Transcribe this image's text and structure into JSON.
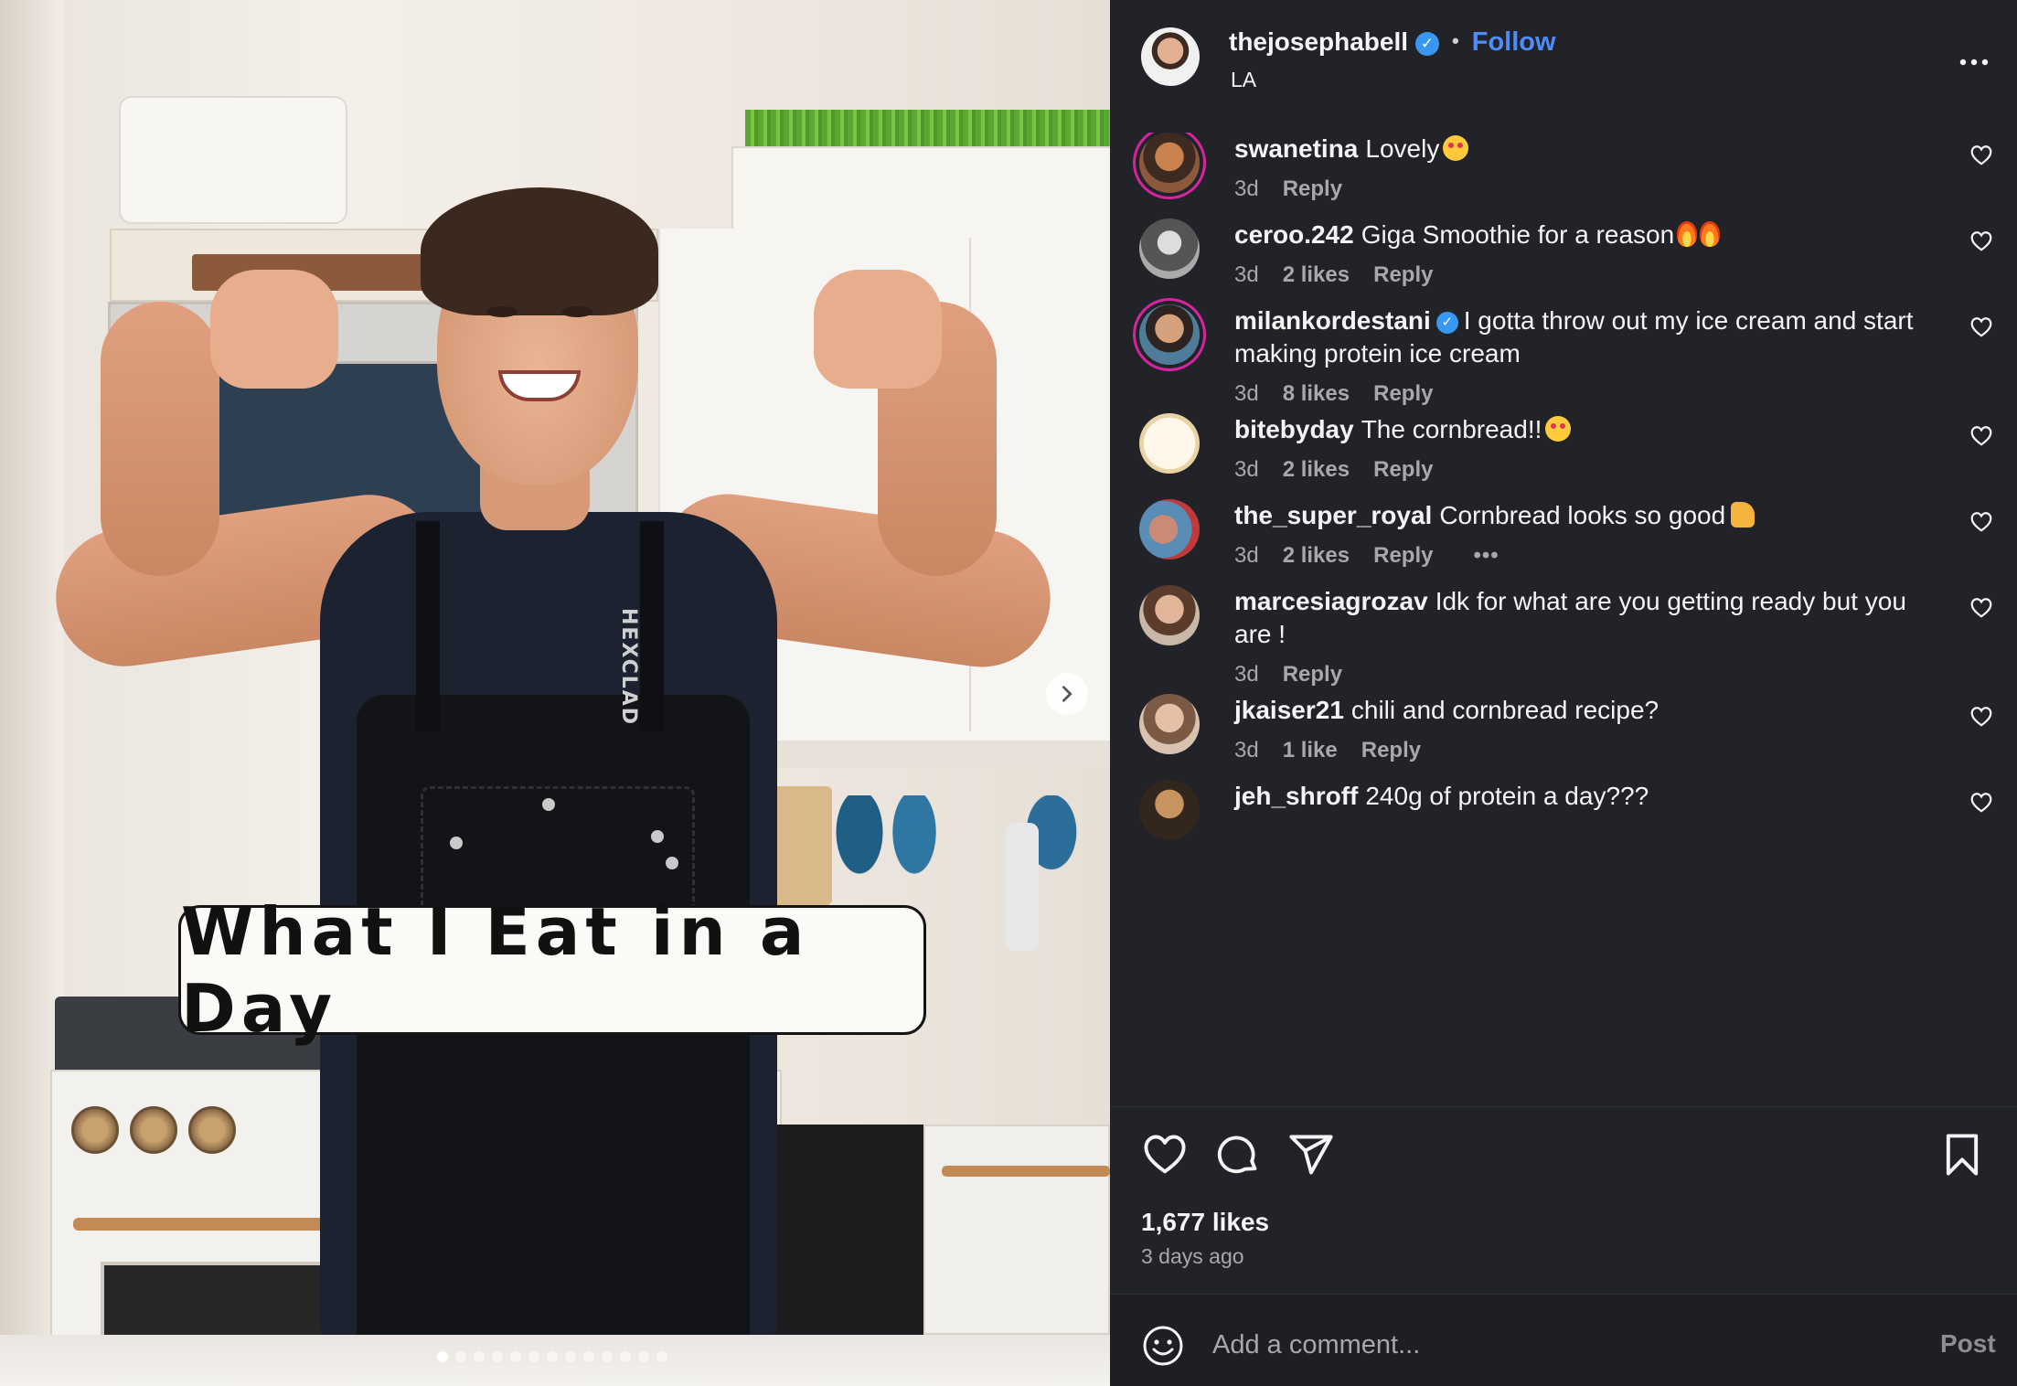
{
  "post": {
    "author": "thejosephabell",
    "separator": "•",
    "follow_label": "Follow",
    "location": "LA",
    "verified_mark": "✓",
    "caption_overlay": "What I Eat in a Day",
    "apron_brand": "HEXCLAD",
    "likes": "1,677 likes",
    "time_ago": "3 days ago",
    "carousel_total": 13,
    "carousel_index": 1
  },
  "comments": [
    {
      "user": "swanetina",
      "text": "Lovely",
      "emoji": "heart-eyes",
      "time": "3d",
      "likes": "",
      "reply": "Reply",
      "verified": false,
      "ring": true
    },
    {
      "user": "ceroo.242",
      "text": "Giga Smoothie for a reason",
      "emoji": "fire-fire",
      "time": "3d",
      "likes": "2 likes",
      "reply": "Reply",
      "verified": false,
      "ring": false
    },
    {
      "user": "milankordestani",
      "text": "I gotta throw out my ice cream and start making protein ice cream",
      "emoji": "",
      "time": "3d",
      "likes": "8 likes",
      "reply": "Reply",
      "verified": true,
      "ring": true
    },
    {
      "user": "bitebyday",
      "text": "The cornbread!!",
      "emoji": "heart-eyes",
      "time": "3d",
      "likes": "2 likes",
      "reply": "Reply",
      "verified": false,
      "ring": false
    },
    {
      "user": "the_super_royal",
      "text": "Cornbread looks so good",
      "emoji": "thumbs-up",
      "time": "3d",
      "likes": "2 likes",
      "reply": "Reply",
      "verified": false,
      "ring": false,
      "more": "•••"
    },
    {
      "user": "marcesiagrozav",
      "text": "Idk for what are you getting ready but you are !",
      "emoji": "",
      "time": "3d",
      "likes": "",
      "reply": "Reply",
      "verified": false,
      "ring": false
    },
    {
      "user": "jkaiser21",
      "text": "chili and cornbread recipe?",
      "emoji": "",
      "time": "3d",
      "likes": "1 like",
      "reply": "Reply",
      "verified": false,
      "ring": false
    },
    {
      "user": "jeh_shroff",
      "text": "240g of protein a day???",
      "emoji": "",
      "time": "",
      "likes": "",
      "reply": "",
      "verified": false,
      "ring": false
    }
  ],
  "add_comment": {
    "placeholder": "Add a comment...",
    "post_label": "Post"
  },
  "icons": {
    "like": "heart-icon",
    "comment": "comment-icon",
    "share": "send-icon",
    "save": "bookmark-icon",
    "emoji": "smiley-icon",
    "more": "more-options-icon",
    "next": "chevron-right-icon"
  },
  "colors": {
    "panel_bg": "#212328",
    "follow_blue": "#4f8cf7",
    "verified_blue": "#3897f0",
    "muted_text": "#a8a8a8"
  }
}
